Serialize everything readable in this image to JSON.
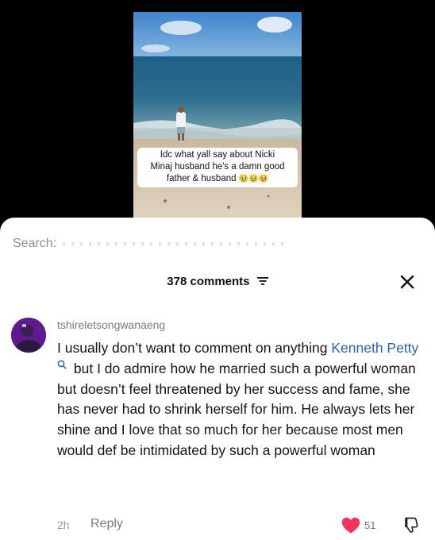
{
  "video": {
    "caption_lines": [
      "Idc what yall say about Nicki",
      "Minaj husband he's a damn good",
      "father & husband"
    ],
    "caption_emoji": "🥹🥹🥹"
  },
  "search": {
    "label": "Search:"
  },
  "header": {
    "comments_count": "378 comments"
  },
  "comment": {
    "username": "tshireletsongwanaeng",
    "text_before": "I usually don’t want to comment on anything",
    "mention": "Kenneth Petty",
    "text_after": "but I do admire how he married such a powerful woman but doesn’t feel threatened by her success and fame, she has never had to shrink herself for him. He always lets her shine and I love that so much for her because most men would def be intimidated by such a powerful woman",
    "time": "2h",
    "reply_label": "Reply",
    "likes": "51"
  },
  "colors": {
    "like": "#f0345a",
    "mention": "#2e62b5",
    "avatar": "#6a1b9a"
  }
}
